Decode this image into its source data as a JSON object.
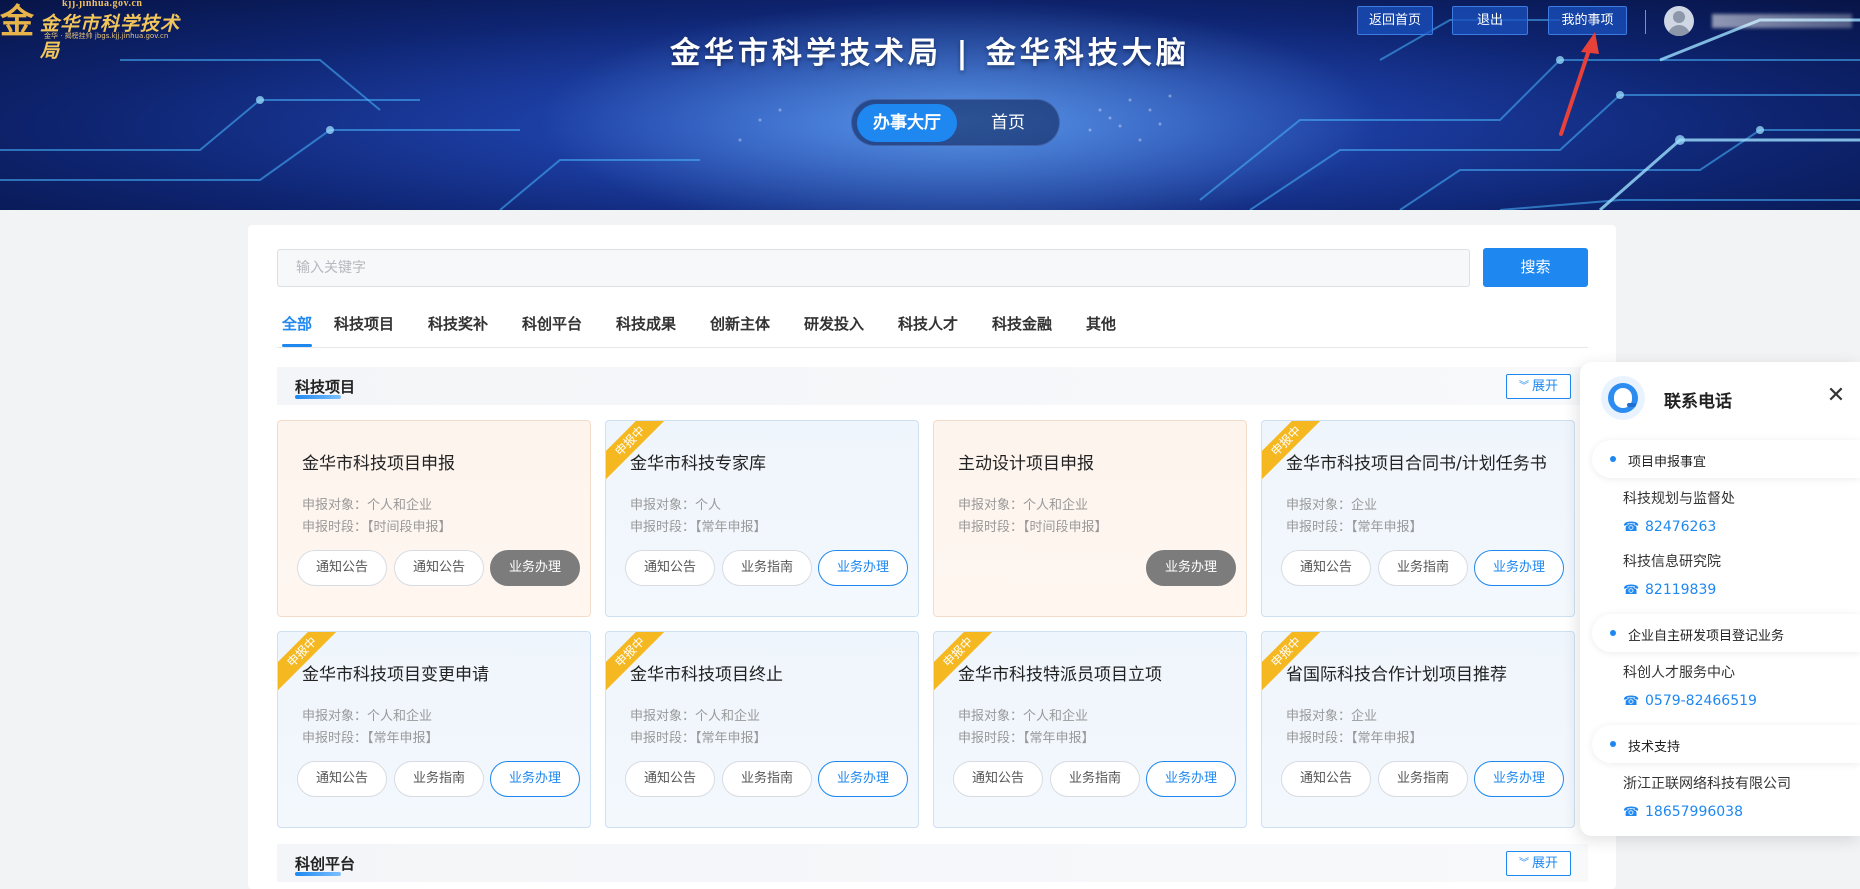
{
  "header": {
    "logo_url_text": "kjj.jinhua.gov.cn",
    "logo_name": "金华市科学技术局",
    "logo_sub": "金华 · 揭榜挂帅 jbgs.kjj.jinhua.gov.cn",
    "site_title": "金华市科学技术局 | 金华科技大脑",
    "buttons": {
      "back": "返回首页",
      "logout": "退出",
      "my_items": "我的事项"
    },
    "hall_switch": {
      "active": "办事大厅",
      "home": "首页"
    }
  },
  "search": {
    "placeholder": "输入关键字",
    "button": "搜索"
  },
  "tabs": [
    "全部",
    "科技项目",
    "科技奖补",
    "科创平台",
    "科技成果",
    "创新主体",
    "研发投入",
    "科技人才",
    "科技金融",
    "其他"
  ],
  "section1": {
    "title": "科技项目",
    "expand": "展开",
    "cards": [
      {
        "title": "金华市科技项目申报",
        "target": "申报对象：个人和企业",
        "period": "申报时段：【时间段申报】",
        "badge": "",
        "btn1": "通知公告",
        "btn2": "通知公告",
        "btn3": "业务办理"
      },
      {
        "title": "金华市科技专家库",
        "target": "申报对象：个人",
        "period": "申报时段：【常年申报】",
        "badge": "申报中",
        "btn1": "通知公告",
        "btn2": "业务指南",
        "btn3": "业务办理"
      },
      {
        "title": "主动设计项目申报",
        "target": "申报对象：个人和企业",
        "period": "申报时段：【时间段申报】",
        "badge": "",
        "btn3": "业务办理"
      },
      {
        "title": "金华市科技项目合同书/计划任务书",
        "target": "申报对象：企业",
        "period": "申报时段：【常年申报】",
        "badge": "申报中",
        "btn1": "通知公告",
        "btn2": "业务指南",
        "btn3": "业务办理"
      },
      {
        "title": "金华市科技项目变更申请",
        "target": "申报对象：个人和企业",
        "period": "申报时段：【常年申报】",
        "badge": "申报中",
        "btn1": "通知公告",
        "btn2": "业务指南",
        "btn3": "业务办理"
      },
      {
        "title": "金华市科技项目终止",
        "target": "申报对象：个人和企业",
        "period": "申报时段：【常年申报】",
        "badge": "申报中",
        "btn1": "通知公告",
        "btn2": "业务指南",
        "btn3": "业务办理"
      },
      {
        "title": "金华市科技特派员项目立项",
        "target": "申报对象：个人和企业",
        "period": "申报时段：【常年申报】",
        "badge": "申报中",
        "btn1": "通知公告",
        "btn2": "业务指南",
        "btn3": "业务办理"
      },
      {
        "title": "省国际科技合作计划项目推荐",
        "target": "申报对象：企业",
        "period": "申报时段：【常年申报】",
        "badge": "申报中",
        "btn1": "通知公告",
        "btn2": "业务指南",
        "btn3": "业务办理"
      }
    ]
  },
  "section2": {
    "title": "科创平台",
    "expand": "展开"
  },
  "contact": {
    "title": "联系电话",
    "groups": [
      {
        "category": "项目申报事宜",
        "entries": [
          {
            "org": "科技规划与监督处",
            "phone": "82476263"
          },
          {
            "org": "科技信息研究院",
            "phone": "82119839"
          }
        ]
      },
      {
        "category": "企业自主研发项目登记业务",
        "entries": [
          {
            "org": "科创人才服务中心",
            "phone": "0579-82466519"
          }
        ]
      },
      {
        "category": "技术支持",
        "entries": [
          {
            "org": "浙江正联网络科技有限公司",
            "phone": "18657996038"
          }
        ]
      }
    ]
  },
  "colors": {
    "primary": "#1e88f0",
    "ribbon": "#f5b820",
    "disabled_button": "#7c7c7c",
    "banner": "#1a3a9c"
  },
  "icons": {
    "close": "close-icon",
    "phone": "phone-icon",
    "expand": "double-chevron-down-icon",
    "service": "customer-service-icon",
    "user": "user-avatar-icon"
  }
}
